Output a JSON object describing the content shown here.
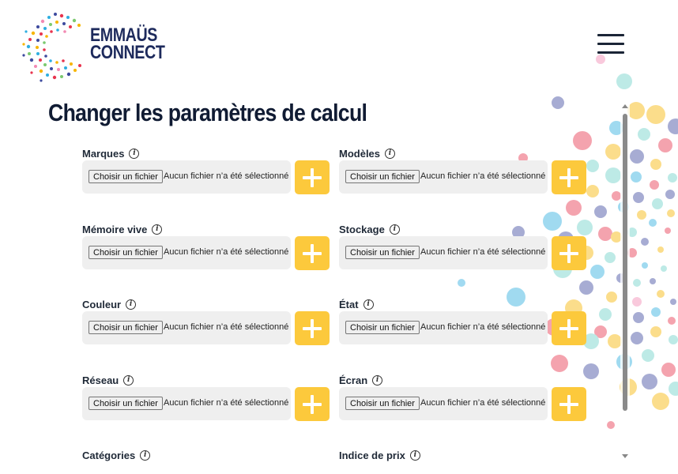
{
  "brand": {
    "line1": "EMMAÜS",
    "line2": "CONNECT",
    "color": "#1d2a5c",
    "dot_colors": [
      "#e8344e",
      "#f7b500",
      "#2eaee0",
      "#7bc96f",
      "#3d4a9e",
      "#f28ab3",
      "#6fd1c9"
    ]
  },
  "menu": {
    "icon": "hamburger-menu-icon"
  },
  "page": {
    "title": "Changer les paramètres de calcul"
  },
  "file_input": {
    "button_label": "Choisir un fichier",
    "status": "Aucun fichier n’a été sélectionné"
  },
  "fields": [
    {
      "label": "Marques"
    },
    {
      "label": "Modèles"
    },
    {
      "label": "Mémoire vive"
    },
    {
      "label": "Stockage"
    },
    {
      "label": "Couleur"
    },
    {
      "label": "État"
    },
    {
      "label": "Réseau"
    },
    {
      "label": "Écran"
    },
    {
      "label": "Catégories"
    },
    {
      "label": "Indice de prix"
    }
  ],
  "icons": {
    "info": "i",
    "add": "plus-icon"
  },
  "colors": {
    "accent": "#fcc93c",
    "title": "#101b33",
    "field_bg": "#efefef"
  }
}
